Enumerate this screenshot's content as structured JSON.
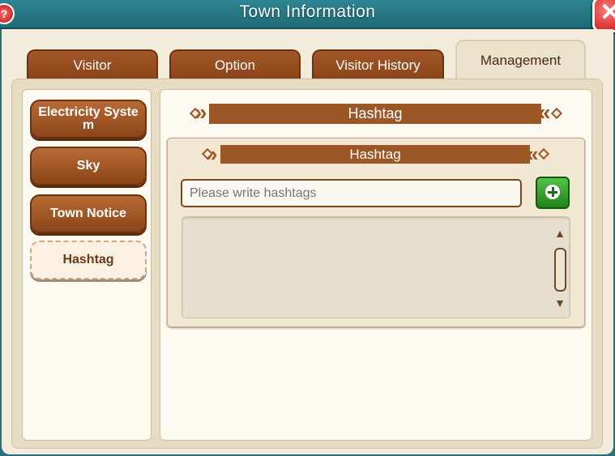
{
  "window": {
    "title": "Town Information"
  },
  "tabs": [
    "Visitor",
    "Option",
    "Visitor History",
    "Management"
  ],
  "menu": [
    "Electricity Syste m",
    "Sky",
    "Town Notice",
    "Hashtag"
  ],
  "content": {
    "header": "Hashtag",
    "subheader": "Hashtag",
    "input_placeholder": "Please write hashtags",
    "input_value": ""
  },
  "icons": {
    "help": "?",
    "close": "✕",
    "add": "plus-icon",
    "scroll_up": "▲",
    "scroll_down": "▼"
  },
  "colors": {
    "titlebar": "#2f8592",
    "tab_brown": "#8a4317",
    "banner_brown": "#9c5726",
    "add_green": "#2f9a27",
    "panel_bg": "#f3ecdc"
  }
}
